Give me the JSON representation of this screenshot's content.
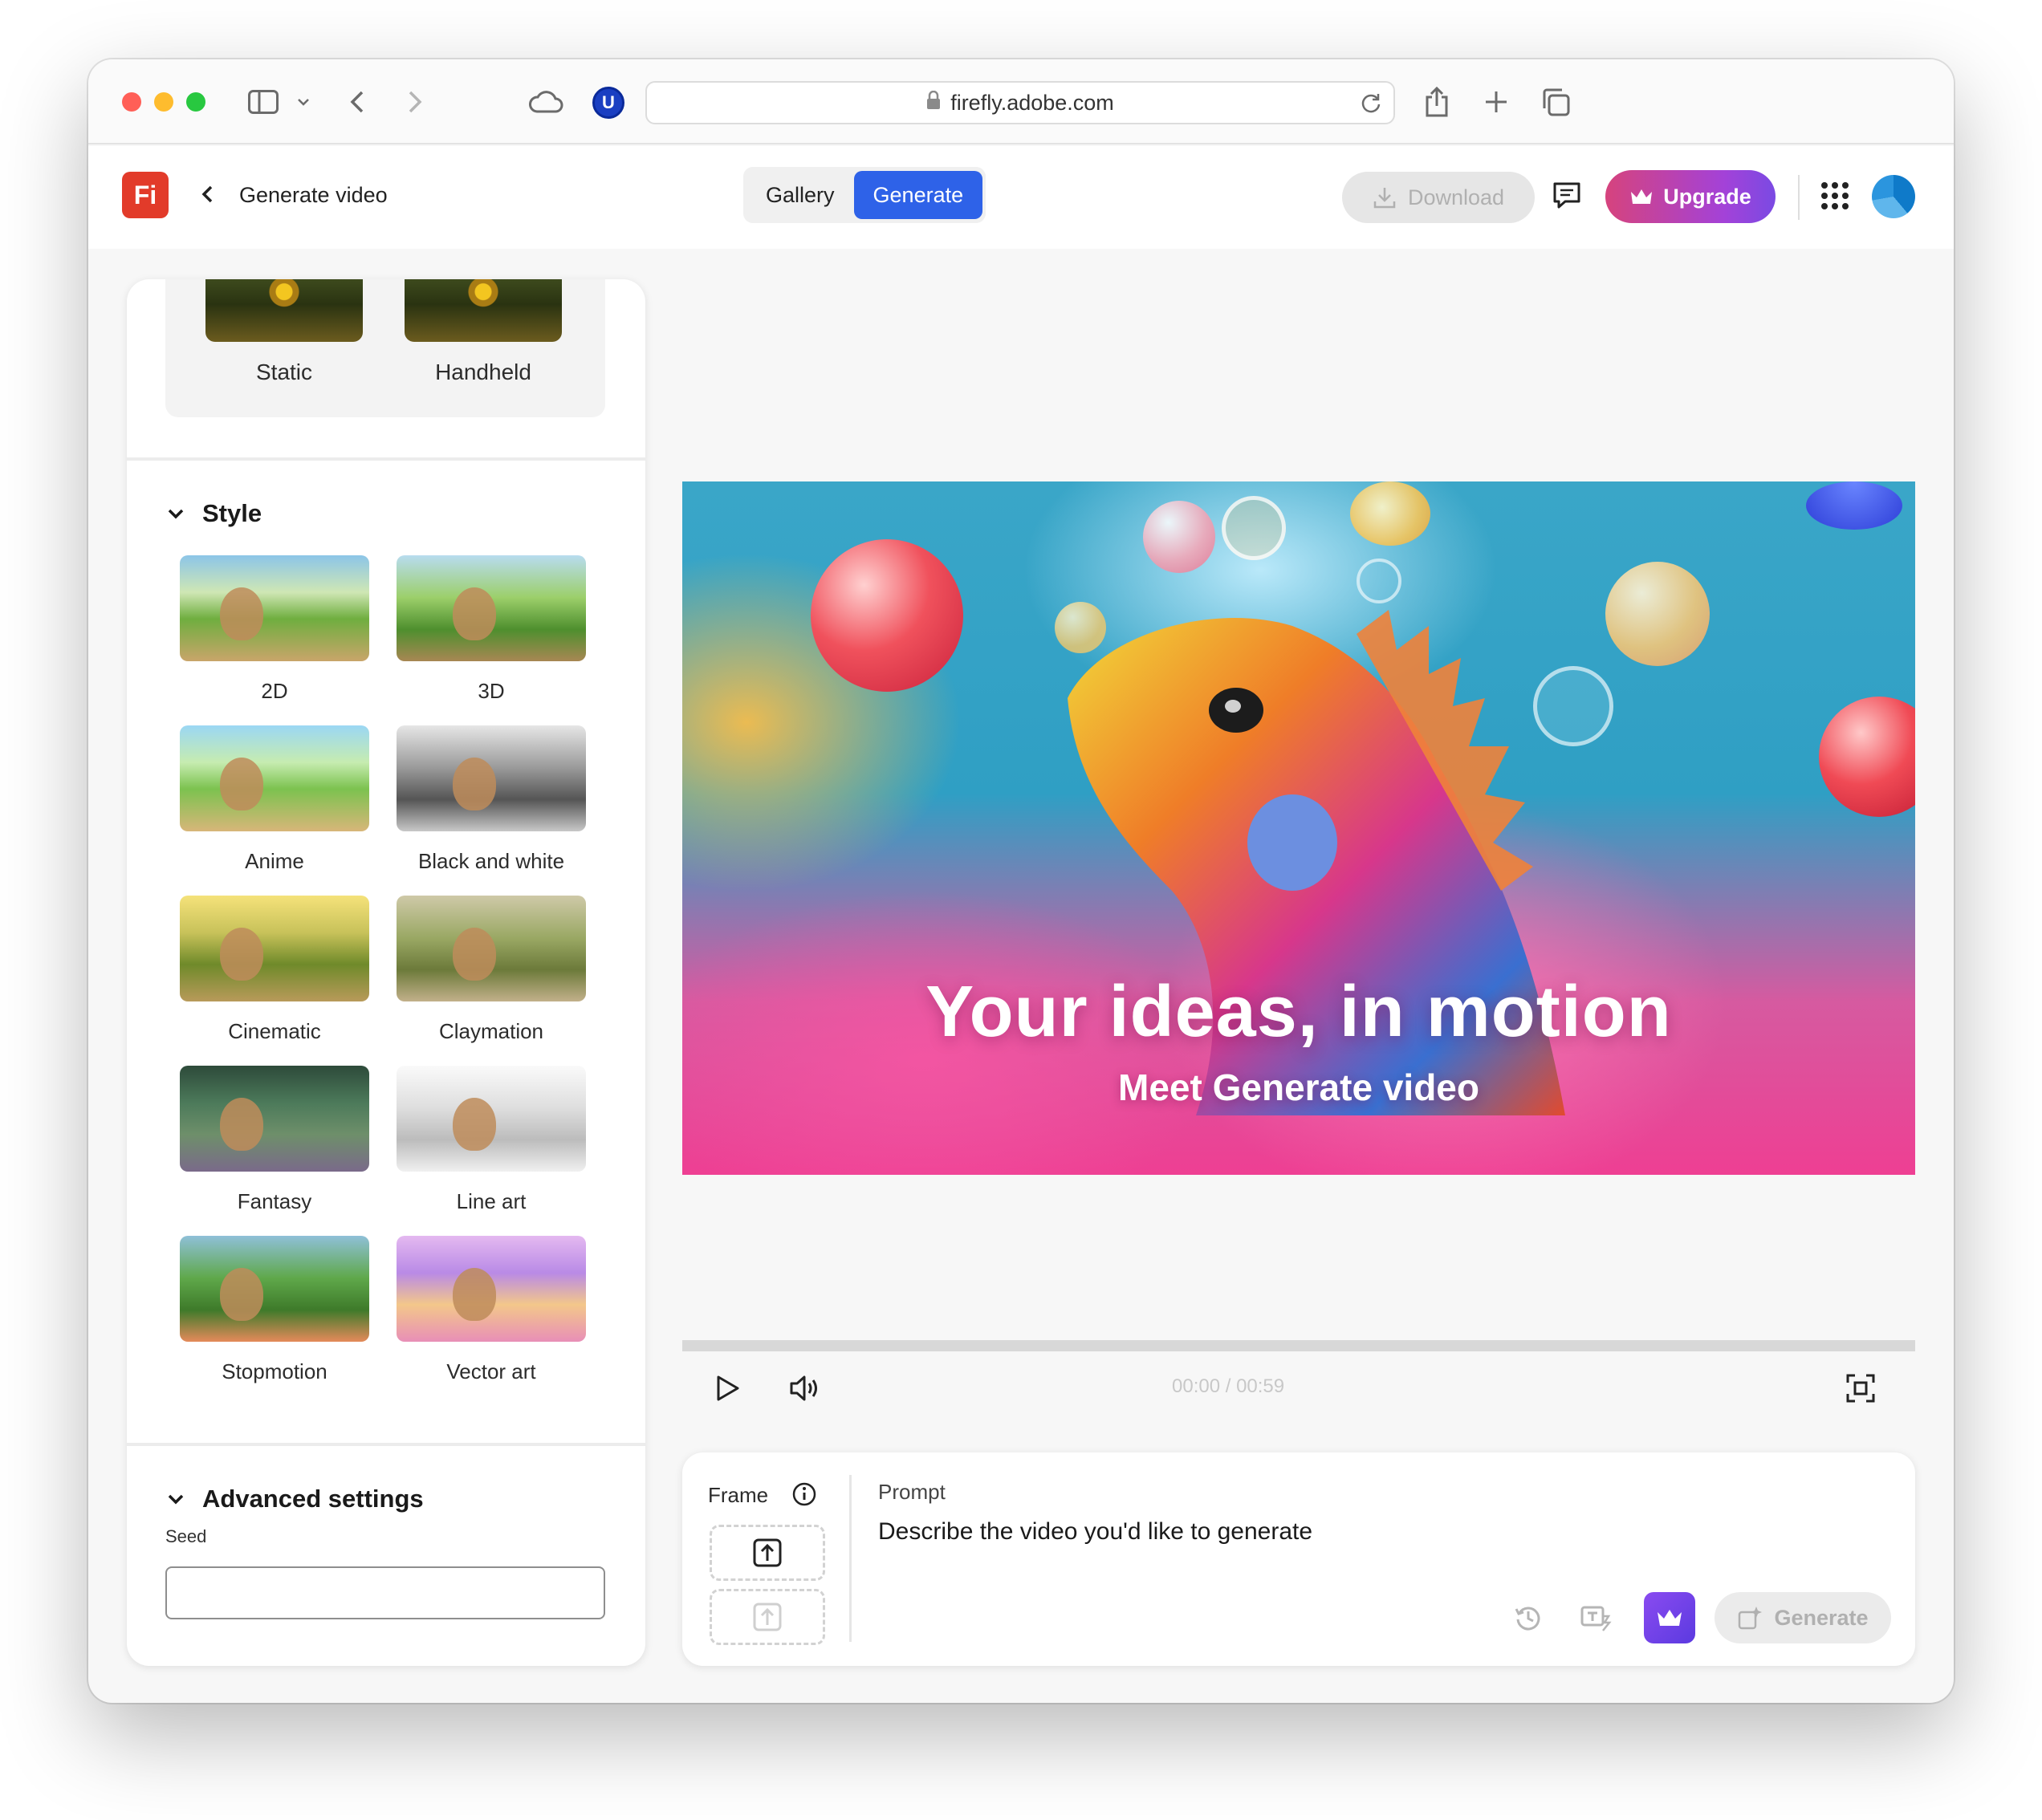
{
  "browser": {
    "url": "firefly.adobe.com",
    "extension_letter": "U",
    "traffic_lights": [
      "#ff5f57",
      "#febc2e",
      "#28c840"
    ]
  },
  "app": {
    "logo_text": "Fi",
    "title": "Generate video",
    "tabs": [
      {
        "label": "Gallery",
        "active": false
      },
      {
        "label": "Generate",
        "active": true
      }
    ],
    "download_label": "Download",
    "upgrade_label": "Upgrade",
    "colors": {
      "accent": "#2e62e8",
      "logo": "#e23b2a",
      "upgrade_from": "#d6437d",
      "upgrade_to": "#7a4ae3"
    }
  },
  "sidebar": {
    "camera_motion": [
      "Static",
      "Handheld"
    ],
    "style": {
      "heading": "Style",
      "items": [
        "2D",
        "3D",
        "Anime",
        "Black and white",
        "Cinematic",
        "Claymation",
        "Fantasy",
        "Line art",
        "Stopmotion",
        "Vector art"
      ]
    },
    "advanced": {
      "heading": "Advanced settings",
      "seed_label": "Seed",
      "seed_value": ""
    }
  },
  "video": {
    "title": "Your ideas, in motion",
    "subtitle": "Meet Generate video",
    "time_current": "00:00",
    "time_total": "00:59",
    "time_display": "00:00 / 00:59",
    "progress": 0
  },
  "prompt": {
    "frame_label": "Frame",
    "label": "Prompt",
    "placeholder": "Describe the video you'd like to generate",
    "generate_label": "Generate"
  }
}
